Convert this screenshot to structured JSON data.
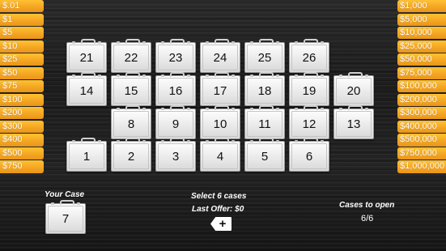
{
  "left_values": [
    ".01",
    "1",
    "5",
    "10",
    "25",
    "50",
    "75",
    "100",
    "200",
    "300",
    "400",
    "500",
    "750"
  ],
  "right_values": [
    "1,000",
    "5,000",
    "10,000",
    "25,000",
    "50,000",
    "75,000",
    "100,000",
    "200,000",
    "300,000",
    "400,000",
    "500,000",
    "750,000",
    "1,000,000"
  ],
  "currency_symbol": "$",
  "cases": {
    "row1": [
      "21",
      "22",
      "23",
      "24",
      "25",
      "26"
    ],
    "row2": [
      "14",
      "15",
      "16",
      "17",
      "18",
      "19",
      "20"
    ],
    "row3": [
      "8",
      "9",
      "10",
      "11",
      "12",
      "13"
    ],
    "row4": [
      "1",
      "2",
      "3",
      "4",
      "5",
      "6"
    ]
  },
  "your_case": {
    "label": "Your Case",
    "number": "7"
  },
  "center": {
    "instruction": "Select 6 cases",
    "last_offer": "Last Offer: $0",
    "add_button": "+"
  },
  "cases_to_open": {
    "label": "Cases to open",
    "value": "6/6"
  },
  "colors": {
    "ladder_gold": "#f5a623",
    "case_white": "#eeeeee",
    "background": "#1e1e1e"
  },
  "icons": {
    "case_icon": "briefcase-icon"
  }
}
